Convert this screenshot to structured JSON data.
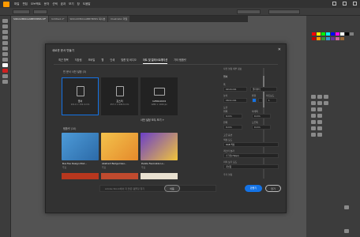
{
  "menu": [
    "파일",
    "편집",
    "오브젝트",
    "문자",
    "선택",
    "효과",
    "보기",
    "창",
    "도움말"
  ],
  "doc_tabs": [
    "SIKCAXMKCAABBYMPRS.tif*",
    "Untitled-1*",
    "SIKCAXMKCAABBYMPRS 복사본",
    "Illustrator 파일"
  ],
  "dialog": {
    "title": "새로운 문서 만들기",
    "close": "✕",
    "tabs": [
      "최근 항목",
      "저장됨",
      "모바일",
      "웹",
      "인쇄",
      "필름 및 비디오",
      "아트 및 일러스트레이션",
      "기타 템플릿"
    ],
    "active_tab_index": 6,
    "recent_section": "빈 문서 사전 설정 (3)",
    "presets": [
      {
        "name": "엽서",
        "size": "101.6 × 152.4 mm"
      },
      {
        "name": "포스터",
        "size": "457.2 × 609.6 mm"
      },
      {
        "name": "1280x1024",
        "size": "1280 × 1024 px"
      }
    ],
    "more_presets": "사전 설정 모두 보기 +",
    "templates_section": "템플릿 (10)",
    "templates": [
      {
        "name": "Bus Fee Design Mod...",
        "tag": "무료"
      },
      {
        "name": "Abstract Badge Desi...",
        "tag": "무료"
      },
      {
        "name": "Puzzle Favorable Lo...",
        "tag": "무료"
      }
    ],
    "search_placeholder": "Adobe Stock에서 더 많은 템플릿 찾기",
    "go_label": "이동",
    "details": {
      "header": "사전 설정 세부 정보",
      "doc_name": "엽서",
      "width_label": "폭",
      "width_value": "101.6 mm",
      "unit_value": "밀리미터",
      "height_label": "높이",
      "height_value": "152.4 mm",
      "orient_label": "방향",
      "artboards_label": "아트보드",
      "artboards_value": "1",
      "bleed_label": "도련",
      "top_label": "위쪽",
      "top_value": "0 mm",
      "bottom_label": "아래쪽",
      "bottom_value": "0 mm",
      "left_label": "왼쪽",
      "left_value": "0 mm",
      "right_label": "오른쪽",
      "right_value": "0 mm",
      "advanced_label": "고급 옵션",
      "color_mode_label": "색상 모드",
      "color_mode_value": "RGB 색상",
      "raster_label": "래스터 효과",
      "raster_value": "스크린(72ppi)",
      "preview_label": "미리 보기 모드",
      "preview_value": "기본값",
      "more_settings": "추가 설정"
    },
    "create_label": "만들기",
    "close_label": "닫기"
  },
  "colors": {
    "accent": "#1473e6",
    "app_bg": "#535353",
    "dialog_bg": "#323232"
  }
}
